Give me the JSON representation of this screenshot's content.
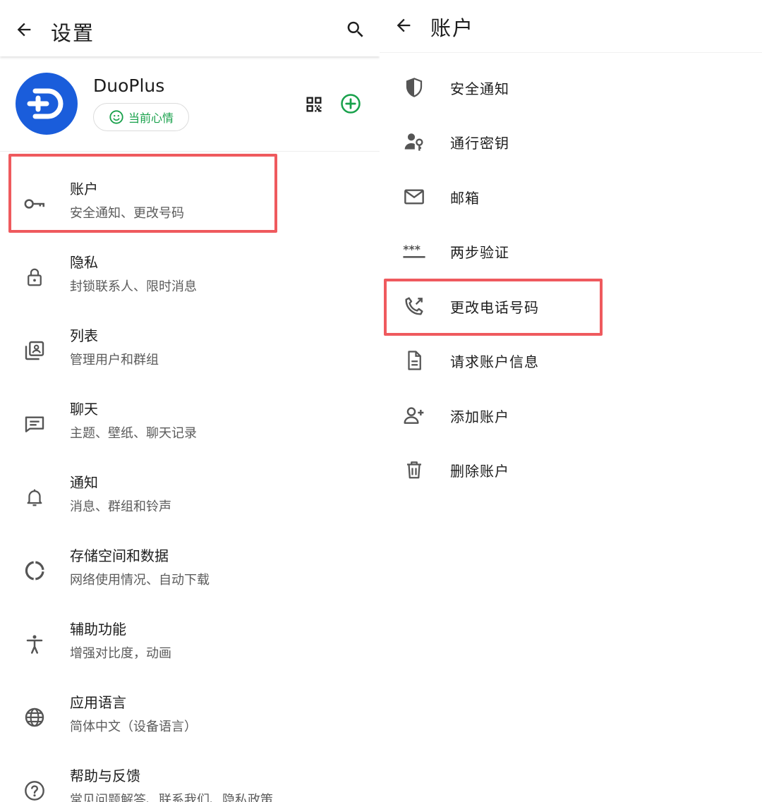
{
  "left": {
    "header": {
      "title": "设置",
      "back_icon": "arrow-left-icon",
      "search_icon": "search-icon"
    },
    "profile": {
      "name": "DuoPlus",
      "mood_label": "当前心情",
      "avatar_color": "#1a5ddb",
      "accent_color": "#18a14b"
    },
    "items": [
      {
        "icon": "key-icon",
        "title": "账户",
        "subtitle": "安全通知、更改号码"
      },
      {
        "icon": "lock-icon",
        "title": "隐私",
        "subtitle": "封锁联系人、限时消息"
      },
      {
        "icon": "lists-icon",
        "title": "列表",
        "subtitle": "管理用户和群组"
      },
      {
        "icon": "chat-icon",
        "title": "聊天",
        "subtitle": "主题、壁纸、聊天记录"
      },
      {
        "icon": "bell-icon",
        "title": "通知",
        "subtitle": "消息、群组和铃声"
      },
      {
        "icon": "storage-icon",
        "title": "存储空间和数据",
        "subtitle": "网络使用情况、自动下载"
      },
      {
        "icon": "accessibility-icon",
        "title": "辅助功能",
        "subtitle": "增强对比度，动画"
      },
      {
        "icon": "globe-icon",
        "title": "应用语言",
        "subtitle": "简体中文（设备语言）"
      },
      {
        "icon": "help-icon",
        "title": "帮助与反馈",
        "subtitle": "常见问题解答、联系我们、隐私政策"
      }
    ]
  },
  "right": {
    "header": {
      "title": "账户",
      "back_icon": "arrow-left-icon"
    },
    "items": [
      {
        "icon": "shield-icon",
        "title": "安全通知"
      },
      {
        "icon": "passkey-icon",
        "title": "通行密钥"
      },
      {
        "icon": "mail-icon",
        "title": "邮箱"
      },
      {
        "icon": "password-dots-icon",
        "title": "两步验证"
      },
      {
        "icon": "phone-change-icon",
        "title": "更改电话号码"
      },
      {
        "icon": "document-icon",
        "title": "请求账户信息"
      },
      {
        "icon": "add-person-icon",
        "title": "添加账户"
      },
      {
        "icon": "trash-icon",
        "title": "删除账户"
      }
    ]
  },
  "highlight_color": "#ef5a5e"
}
